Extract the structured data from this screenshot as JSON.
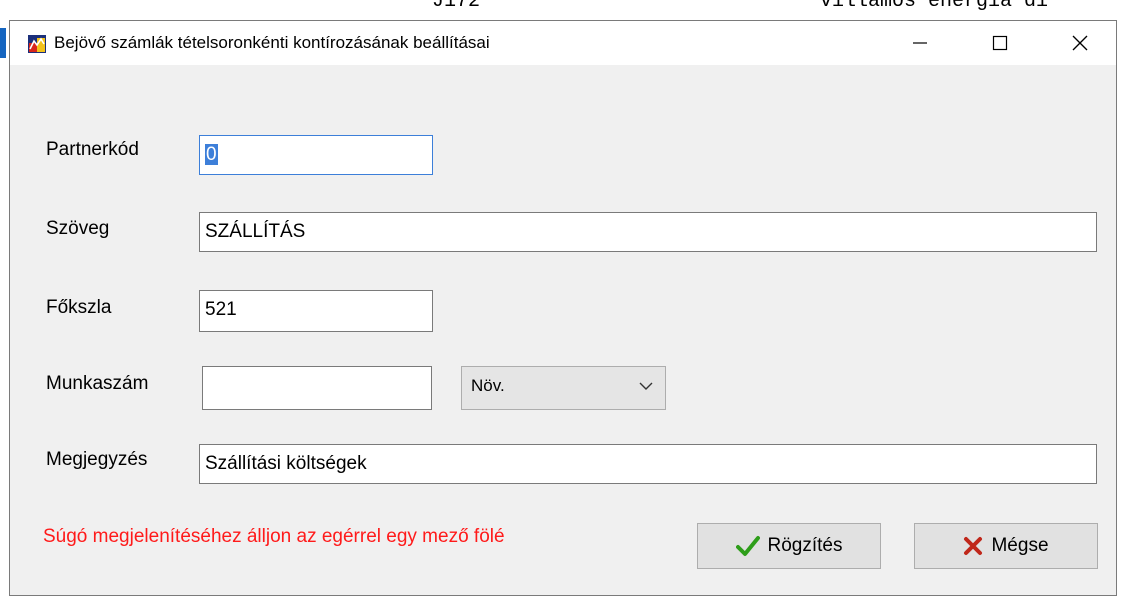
{
  "background": {
    "left_text": "J172",
    "right_text": "villamos energia di"
  },
  "window": {
    "icon": "app-icon",
    "title": "Bejövő számlák tételsoronkénti kontírozásának beállításai",
    "controls": {
      "minimize_icon": "minimize-icon",
      "maximize_icon": "maximize-icon",
      "close_icon": "close-icon"
    }
  },
  "form": {
    "partnerkod": {
      "label": "Partnerkód",
      "value": "0"
    },
    "szoveg": {
      "label": "Szöveg",
      "value": "SZÁLLÍTÁS"
    },
    "fokszla": {
      "label": "Főkszla",
      "value": "521"
    },
    "munkaszam": {
      "label": "Munkaszám",
      "value": "",
      "combo_value": "Növ."
    },
    "megjegyzes": {
      "label": "Megjegyzés",
      "value": "Szállítási költségek"
    }
  },
  "help_text": "Súgó megjelenítéséhez álljon az egérrel egy mező fölé",
  "buttons": {
    "save": {
      "label": "Rögzítés",
      "icon": "checkmark-icon",
      "accent": "#2e9e1a"
    },
    "cancel": {
      "label": "Mégse",
      "icon": "x-icon",
      "accent": "#c0271a"
    }
  },
  "colors": {
    "help_text": "#ff1a1a",
    "focus_border": "#3c7fd9",
    "selection": "#3d7fd9"
  }
}
